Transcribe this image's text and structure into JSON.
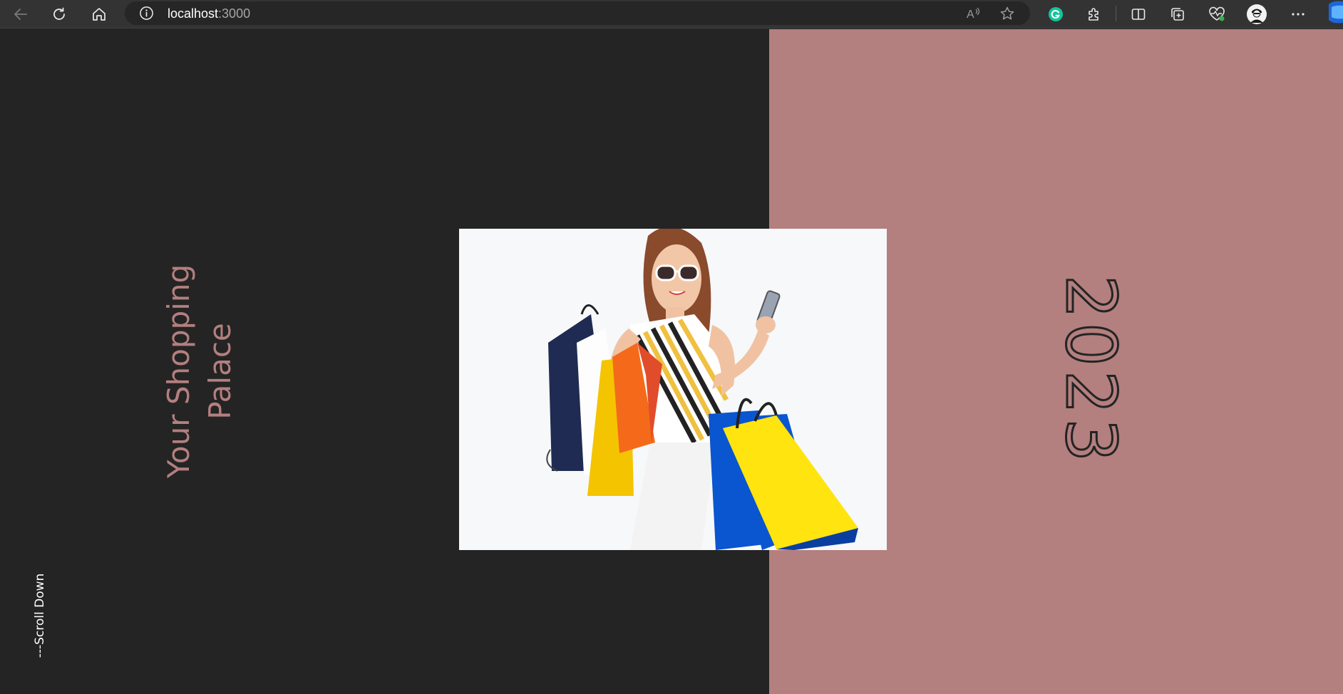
{
  "browser": {
    "address_host": "localhost",
    "address_port": ":3000",
    "icons": {
      "back": "back-arrow-icon",
      "reload": "reload-icon",
      "home": "home-icon",
      "info": "info-icon",
      "read_aloud": "read-aloud-icon",
      "favorite": "star-icon",
      "grammarly": "grammarly-icon",
      "extensions": "puzzle-icon",
      "split_screen": "split-screen-icon",
      "collections": "collections-icon",
      "performance": "heart-pulse-icon",
      "profile": "avatar",
      "more": "more-icon"
    }
  },
  "hero": {
    "title": "Your Shopping\nPalace",
    "scroll_hint": "---Scroll Down",
    "year": "2023",
    "image_alt": "Woman in sunglasses holding shopping bags and a phone"
  },
  "colors": {
    "left_bg": "#242424",
    "right_bg": "#b47f7f",
    "accent_text": "#b47f7f",
    "browser_bar": "#333333"
  }
}
